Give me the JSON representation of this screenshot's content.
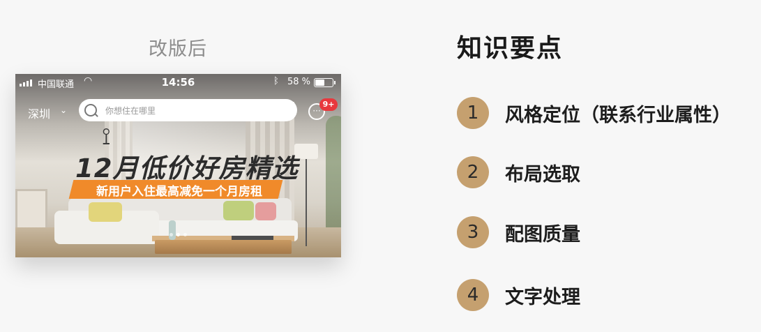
{
  "caption": "改版后",
  "phone": {
    "status_bar": {
      "carrier": "中国联通",
      "time": "14:56",
      "battery_percent": "58 %",
      "battery_level": 0.58
    },
    "nav": {
      "city": "深圳",
      "search_placeholder": "你想住在哪里",
      "message_badge": "9+"
    },
    "banner": {
      "headline": "12月低价好房精选",
      "subline": "新用户入住最高减免一个月房租",
      "carousel_dots": 3,
      "active_dot": 1
    }
  },
  "knowledge_points": {
    "title": "知识要点",
    "items": [
      {
        "num": "1",
        "text": "风格定位（联系行业属性）"
      },
      {
        "num": "2",
        "text": "布局选取"
      },
      {
        "num": "3",
        "text": "配图质量"
      },
      {
        "num": "4",
        "text": "文字处理"
      }
    ]
  },
  "colors": {
    "accent_gold": "#c5a06f",
    "ribbon_orange": "#f08a2a",
    "badge_red": "#e8383d"
  }
}
